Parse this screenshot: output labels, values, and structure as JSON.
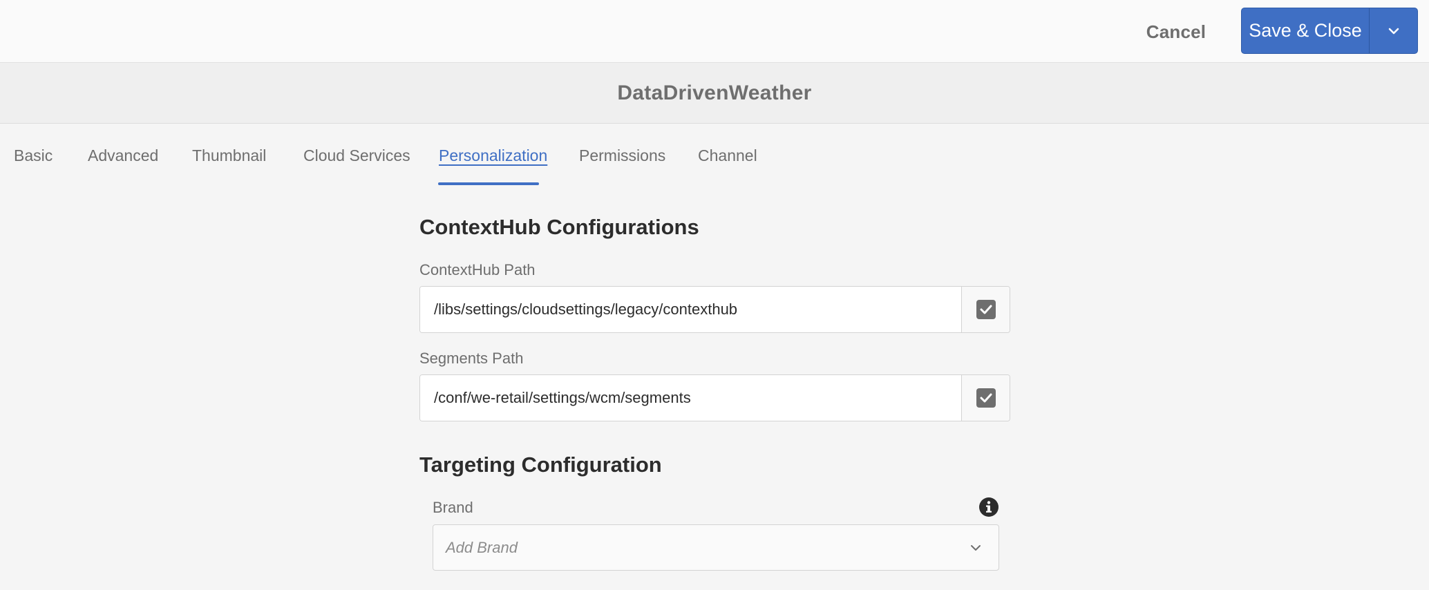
{
  "topbar": {
    "cancel_label": "Cancel",
    "save_label": "Save & Close",
    "save_toggle_icon": "chevron-down-icon",
    "accent_color": "#3f6fc4"
  },
  "title": "DataDrivenWeather",
  "tabs": [
    {
      "label": "Basic",
      "active": false
    },
    {
      "label": "Advanced",
      "active": false
    },
    {
      "label": "Thumbnail",
      "active": false
    },
    {
      "label": "Cloud Services",
      "active": false
    },
    {
      "label": "Personalization",
      "active": true
    },
    {
      "label": "Permissions",
      "active": false
    },
    {
      "label": "Channel",
      "active": false
    }
  ],
  "contexthub": {
    "heading": "ContextHub Configurations",
    "path_label": "ContextHub Path",
    "path_value": "/libs/settings/cloudsettings/legacy/contexthub",
    "path_checked": true,
    "segments_label": "Segments Path",
    "segments_value": "/conf/we-retail/settings/wcm/segments",
    "segments_checked": true
  },
  "targeting": {
    "heading": "Targeting Configuration",
    "brand_label": "Brand",
    "brand_placeholder": "Add Brand",
    "info_icon": "info-icon"
  }
}
